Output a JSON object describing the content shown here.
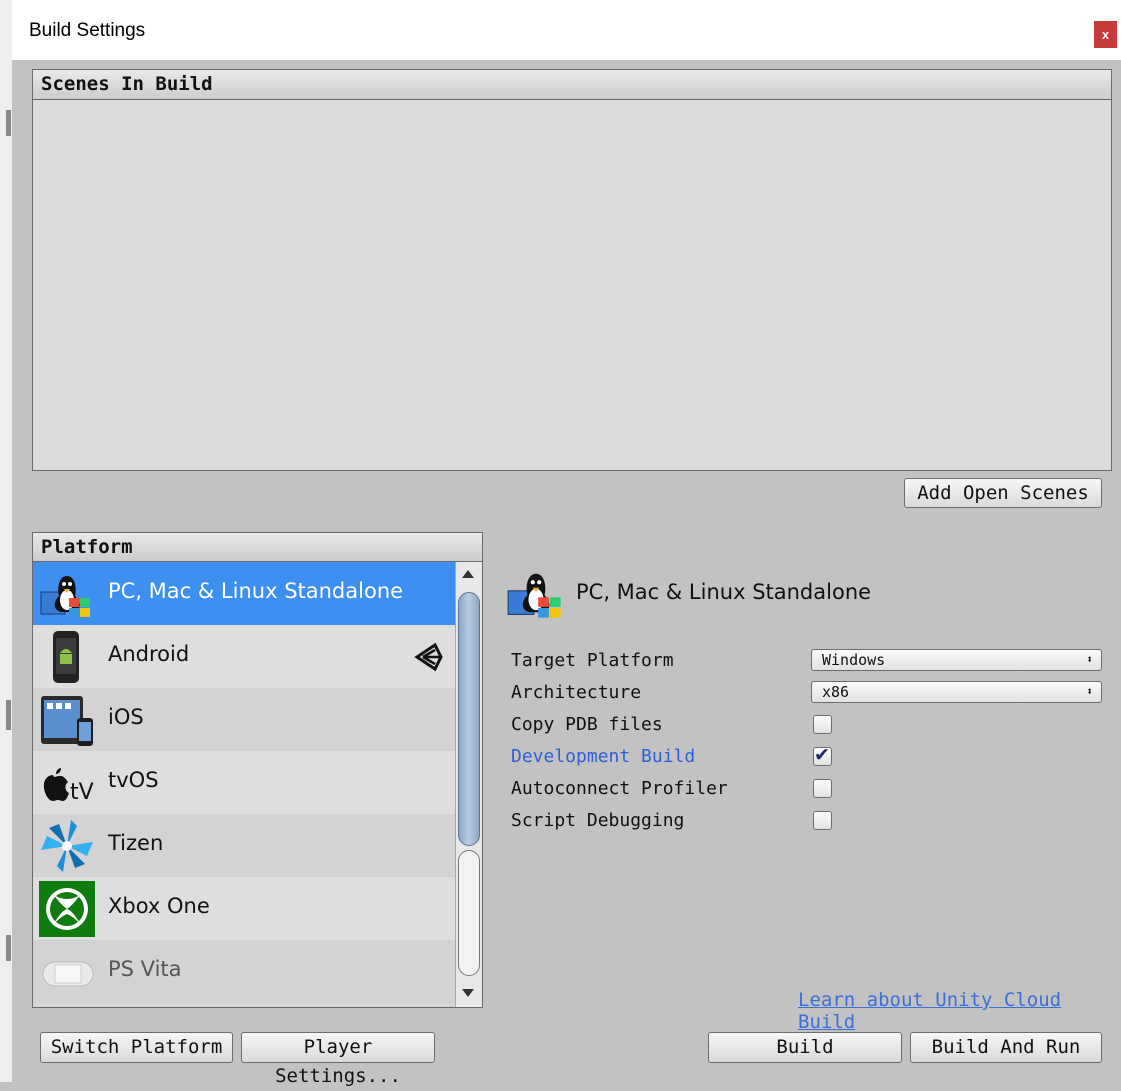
{
  "window": {
    "title": "Build Settings",
    "close_label": "x"
  },
  "scenes": {
    "header": "Scenes In Build",
    "add_open_scenes": "Add Open Scenes"
  },
  "platform": {
    "header": "Platform",
    "items": [
      {
        "label": "PC, Mac & Linux Standalone",
        "icon": "pc-mac-linux-icon",
        "selected": true
      },
      {
        "label": "Android",
        "icon": "android-icon",
        "active_target": true
      },
      {
        "label": "iOS",
        "icon": "ios-icon"
      },
      {
        "label": "tvOS",
        "icon": "apple-tv-icon"
      },
      {
        "label": "Tizen",
        "icon": "tizen-icon"
      },
      {
        "label": "Xbox One",
        "icon": "xbox-icon"
      },
      {
        "label": "PS Vita",
        "icon": "ps-vita-icon"
      }
    ]
  },
  "details": {
    "title": "PC, Mac & Linux Standalone",
    "target_platform_label": "Target Platform",
    "target_platform_value": "Windows",
    "architecture_label": "Architecture",
    "architecture_value": "x86",
    "copy_pdb_label": "Copy PDB files",
    "copy_pdb_checked": false,
    "development_build_label": "Development Build",
    "development_build_checked": true,
    "autoconnect_label": "Autoconnect Profiler",
    "autoconnect_checked": false,
    "script_debugging_label": "Script Debugging",
    "script_debugging_checked": false
  },
  "footer": {
    "cloud_link": "Learn about Unity Cloud Build",
    "switch_platform": "Switch Platform",
    "player_settings": "Player Settings...",
    "build": "Build",
    "build_and_run": "Build And Run"
  },
  "colors": {
    "selection": "#3d8ff0",
    "link": "#3a70d8",
    "close": "#c63a3a"
  }
}
